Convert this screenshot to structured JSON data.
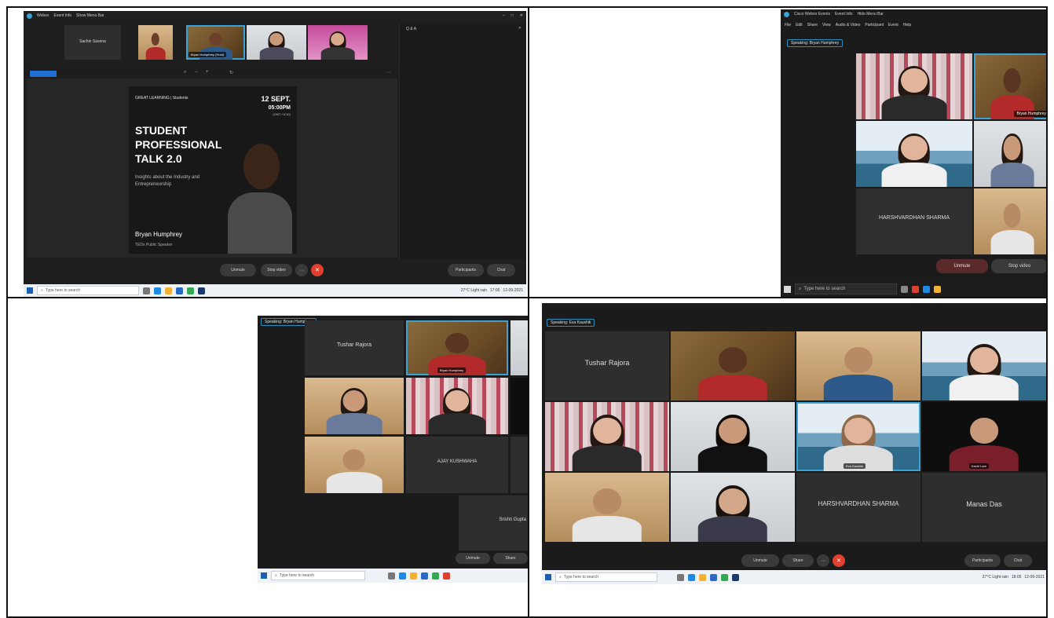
{
  "panel1": {
    "title_items": [
      "Webex",
      "Event Info",
      "Show Menu Bar"
    ],
    "top_tiles": [
      {
        "name": "Sachin Saxena"
      },
      {
        "name": ""
      },
      {
        "name": "Bryan Humphrey (Host)"
      },
      {
        "name": ""
      },
      {
        "name": ""
      }
    ],
    "qa_title": "Q & A",
    "slide": {
      "brand": "GREAT LEARNING | Students",
      "date": "12 SEPT.",
      "time": "05:00PM",
      "tz": "(GMT +5:30)",
      "headline": [
        "STUDENT",
        "PROFESSIONAL",
        "TALK 2.0"
      ],
      "tagline": "Insights about the Industry and Entrepreneurship",
      "speaker_name": "Bryan Humphrey",
      "speaker_role": "TEDx Public Speaker"
    },
    "controls": {
      "unmute": "Unmute",
      "stop_video": "Stop video",
      "participants": "Participants",
      "chat": "Chat"
    },
    "taskbar": {
      "search_placeholder": "Type here to search",
      "weather": "27°C Light rain",
      "time": "17:00",
      "date": "12-09-2021"
    }
  },
  "panel2": {
    "title_items": [
      "Cisco Webex Events",
      "Event Info",
      "Hide Menu Bar"
    ],
    "menu": [
      "File",
      "Edit",
      "Share",
      "View",
      "Audio & Video",
      "Participant",
      "Event",
      "Help"
    ],
    "speaking": "Speaking: Bryan Humphrey",
    "tiles": [
      {
        "name": ""
      },
      {
        "name": "Bryan Humphrey"
      },
      {
        "name": ""
      },
      {
        "name": ""
      },
      {
        "name": "HARSHVARDHAN SHARMA"
      },
      {
        "name": ""
      }
    ],
    "controls": {
      "unmute": "Unmute",
      "stop_video": "Stop video"
    },
    "taskbar": {
      "search_placeholder": "Type here to search"
    }
  },
  "panel3": {
    "speaking": "Speaking: Bryan Humphrey",
    "tiles": [
      {
        "name": "Tushar Rajora"
      },
      {
        "name": "Bryan Humphrey"
      },
      {
        "name": ""
      },
      {
        "name": ""
      },
      {
        "name": ""
      },
      {
        "name": "AJAY KUSHWAHA"
      },
      {
        "name": "Srishti Gupta"
      }
    ],
    "controls": {
      "unmute": "Unmute",
      "share": "Share"
    },
    "taskbar": {
      "search_placeholder": "Type here to search"
    }
  },
  "panel4": {
    "speaking": "Speaking: Eva Kaushik",
    "tiles": [
      {
        "name": "Tushar Rajora"
      },
      {
        "name": ""
      },
      {
        "name": ""
      },
      {
        "name": ""
      },
      {
        "name": ""
      },
      {
        "name": ""
      },
      {
        "name": "Eva Kaushik"
      },
      {
        "name": "Kachl Lam"
      },
      {
        "name": ""
      },
      {
        "name": ""
      },
      {
        "name": "HARSHVARDHAN SHARMA"
      },
      {
        "name": "Manas Das"
      }
    ],
    "controls": {
      "unmute": "Unmute",
      "stop_video": "Share",
      "participants": "Participants",
      "chat": "Chat"
    },
    "taskbar": {
      "search_placeholder": "Type here to search",
      "weather": "27°C Light rain",
      "time": "18:05",
      "date": "12-09-2021"
    }
  },
  "colors": {
    "accent": "#3aa2d4",
    "leave_red": "#e0412f",
    "dark_bg": "#1c1c1c",
    "tile_bg": "#2e2e2e"
  }
}
